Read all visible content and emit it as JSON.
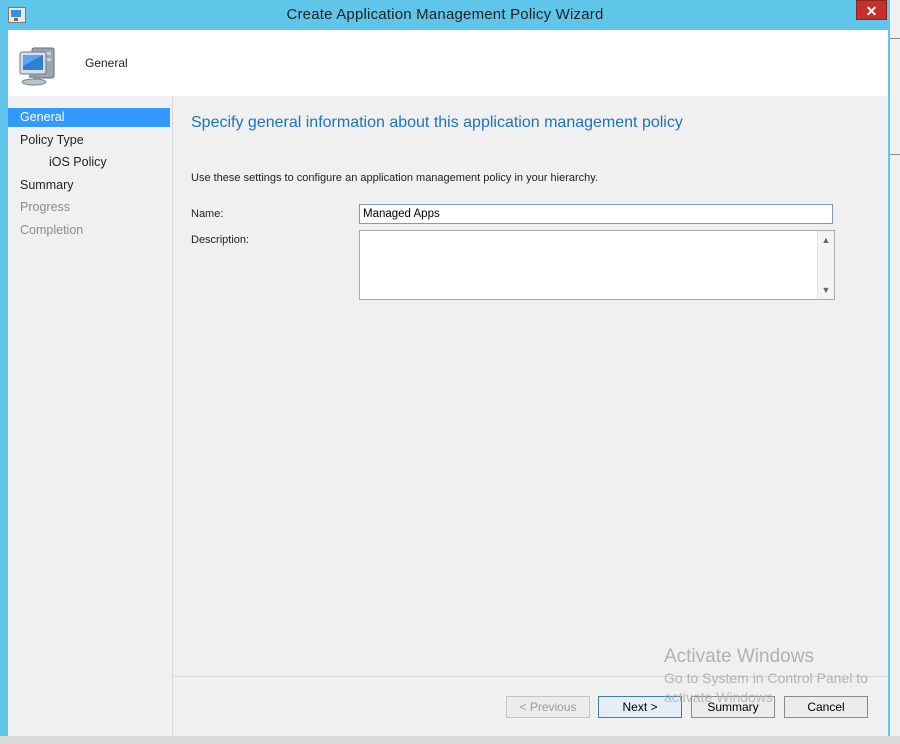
{
  "window": {
    "title": "Create Application Management Policy Wizard",
    "close_glyph": "✕"
  },
  "header": {
    "title": "General",
    "icon": "computer-icon"
  },
  "nav": {
    "items": [
      {
        "label": "General",
        "state": "active"
      },
      {
        "label": "Policy Type",
        "state": "normal"
      },
      {
        "label": "iOS Policy",
        "state": "sub"
      },
      {
        "label": "Summary",
        "state": "normal"
      },
      {
        "label": "Progress",
        "state": "disabled"
      },
      {
        "label": "Completion",
        "state": "disabled"
      }
    ]
  },
  "content": {
    "heading": "Specify general information about this application management policy",
    "instructions": "Use these settings to configure an application management policy in your hierarchy.",
    "name_label": "Name:",
    "name_value": "Managed Apps",
    "description_label": "Description:",
    "description_value": ""
  },
  "buttons": {
    "previous": "< Previous",
    "next": "Next >",
    "summary": "Summary",
    "cancel": "Cancel"
  },
  "watermark": {
    "line1": "Activate Windows",
    "line2": "Go to System in Control Panel to",
    "line3": "activate Windows."
  },
  "colors": {
    "frame": "#5fc6ea",
    "active_nav": "#3399ff",
    "heading": "#1e73be",
    "close": "#c4302b"
  }
}
